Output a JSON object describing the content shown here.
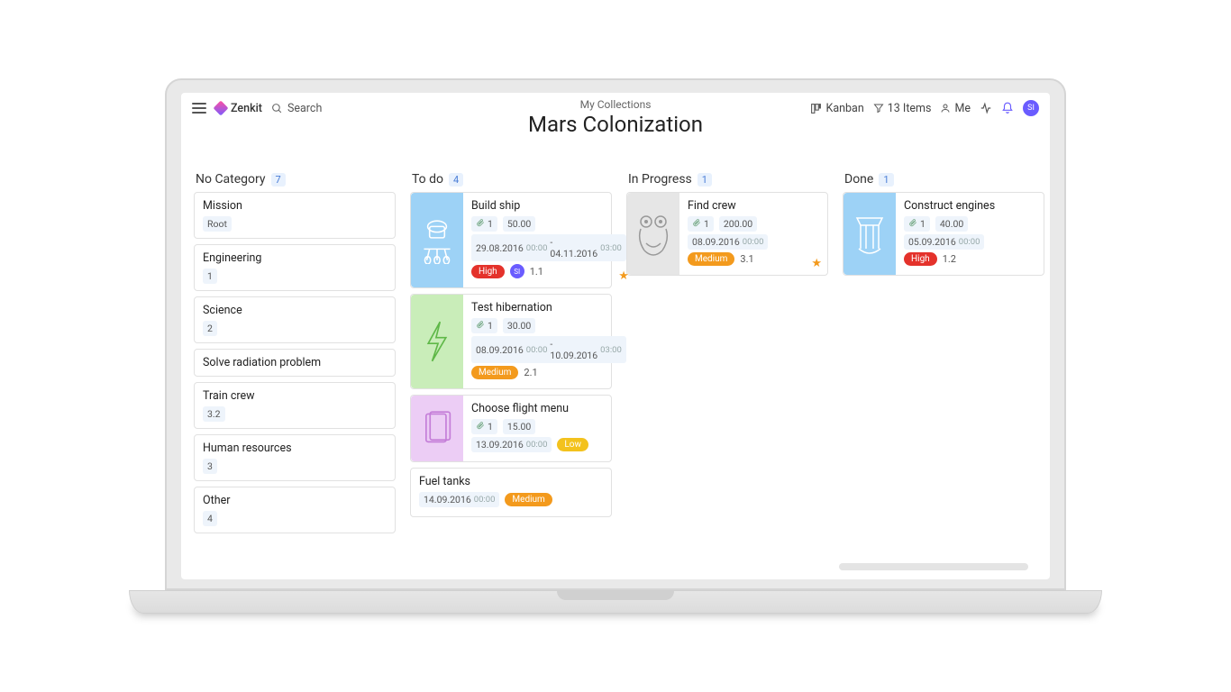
{
  "header": {
    "brand": "Zenkit",
    "search_label": "Search",
    "breadcrumb": "My Collections",
    "title": "Mars Colonization",
    "view_label": "Kanban",
    "items_label": "13 Items",
    "me_label": "Me",
    "avatar_initials": "SI"
  },
  "columns": [
    {
      "title": "No Category",
      "count": "7",
      "cards": [
        {
          "type": "simple",
          "title": "Mission",
          "meta": "Root"
        },
        {
          "type": "simple",
          "title": "Engineering",
          "meta": "1"
        },
        {
          "type": "simple",
          "title": "Science",
          "meta": "2"
        },
        {
          "type": "simple",
          "title": "Solve radiation problem"
        },
        {
          "type": "simple",
          "title": "Train crew",
          "meta": "3.2"
        },
        {
          "type": "simple",
          "title": "Human resources",
          "meta": "3"
        },
        {
          "type": "simple",
          "title": "Other",
          "meta": "4"
        }
      ]
    },
    {
      "title": "To do",
      "count": "4",
      "cards": [
        {
          "type": "rich",
          "thumb": "ship",
          "thumb_bg": "#9dd2f6",
          "title": "Build ship",
          "attach": "1",
          "cost": "50.00",
          "date_main": "29.08.2016",
          "date_time": "00:00",
          "date2_main": "04.11.2016",
          "date2_time": "03:00",
          "priority": "High",
          "assignee": "SI",
          "version": "1.1",
          "starred": true
        },
        {
          "type": "rich",
          "thumb": "bolt",
          "thumb_bg": "#c9edb9",
          "title": "Test hibernation",
          "attach": "1",
          "cost": "30.00",
          "date_main": "08.09.2016",
          "date_time": "00:00",
          "date2_main": "10.09.2016",
          "date2_time": "03:00",
          "priority": "Medium",
          "version": "2.1"
        },
        {
          "type": "rich",
          "thumb": "menu",
          "thumb_bg": "#eccdf5",
          "title": "Choose flight menu",
          "attach": "1",
          "cost": "15.00",
          "date_main": "13.09.2016",
          "date_time": "00:00",
          "priority": "Low"
        },
        {
          "type": "plain",
          "title": "Fuel tanks",
          "date_main": "14.09.2016",
          "date_time": "00:00",
          "priority": "Medium"
        }
      ]
    },
    {
      "title": "In Progress",
      "count": "1",
      "cards": [
        {
          "type": "rich",
          "thumb": "alien",
          "thumb_bg": "#e6e6e6",
          "title": "Find crew",
          "attach": "1",
          "cost": "200.00",
          "date_main": "08.09.2016",
          "date_time": "00:00",
          "priority": "Medium",
          "version": "3.1",
          "starred": true
        }
      ]
    },
    {
      "title": "Done",
      "count": "1",
      "cards": [
        {
          "type": "rich",
          "thumb": "engine",
          "thumb_bg": "#9dd2f6",
          "title": "Construct engines",
          "attach": "1",
          "cost": "40.00",
          "date_main": "05.09.2016",
          "date_time": "00:00",
          "priority": "High",
          "version": "1.2"
        }
      ]
    }
  ]
}
